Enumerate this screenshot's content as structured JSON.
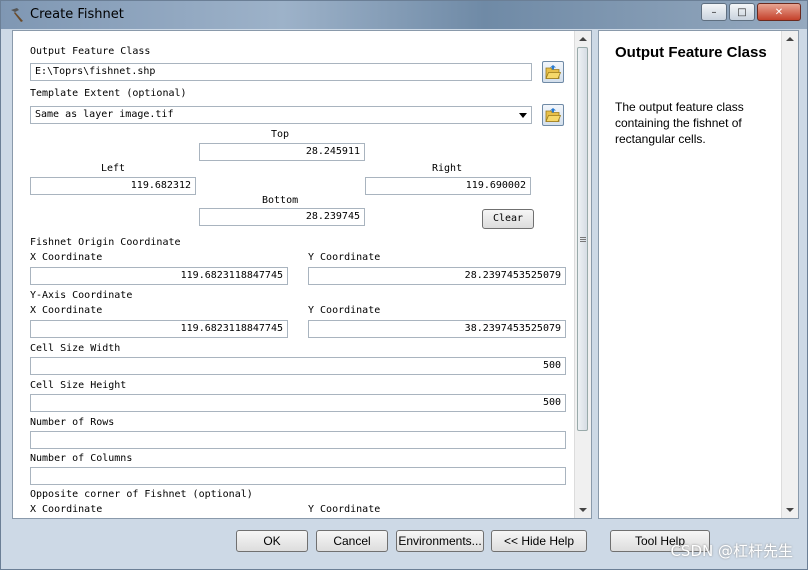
{
  "window": {
    "title": "Create Fishnet"
  },
  "form": {
    "output_label": "Output Feature Class",
    "output_value": "E:\\Toprs\\fishnet.shp",
    "template_label": "Template Extent (optional)",
    "template_value": "Same as layer image.tif",
    "top_label": "Top",
    "top_value": "28.245911",
    "left_label": "Left",
    "left_value": "119.682312",
    "right_label": "Right",
    "right_value": "119.690002",
    "bottom_label": "Bottom",
    "bottom_value": "28.239745",
    "clear_label": "Clear",
    "origin_label": "Fishnet Origin Coordinate",
    "origin_x_label": "X Coordinate",
    "origin_x_value": "119.6823118847745",
    "origin_y_label": "Y Coordinate",
    "origin_y_value": "28.2397453525079",
    "yaxis_label": "Y-Axis Coordinate",
    "yaxis_x_label": "X Coordinate",
    "yaxis_x_value": "119.6823118847745",
    "yaxis_y_label": "Y Coordinate",
    "yaxis_y_value": "38.2397453525079",
    "cell_width_label": "Cell Size Width",
    "cell_width_value": "500",
    "cell_height_label": "Cell Size Height",
    "cell_height_value": "500",
    "rows_label": "Number of Rows",
    "rows_value": "",
    "cols_label": "Number of Columns",
    "cols_value": "",
    "opposite_label": "Opposite corner of Fishnet (optional)",
    "opp_x_label": "X Coordinate",
    "opp_y_label": "Y Coordinate"
  },
  "help": {
    "title": "Output Feature Class",
    "body": "The output feature class containing the fishnet of rectangular cells."
  },
  "buttons": {
    "ok": "OK",
    "cancel": "Cancel",
    "environments": "Environments...",
    "hide_help": "<< Hide Help",
    "tool_help": "Tool Help"
  },
  "watermark": "CSDN @杠杆先生",
  "icons": {
    "title": "hammer-icon",
    "output_browse": "folder-open-icon",
    "template_browse": "folder-open-icon"
  }
}
